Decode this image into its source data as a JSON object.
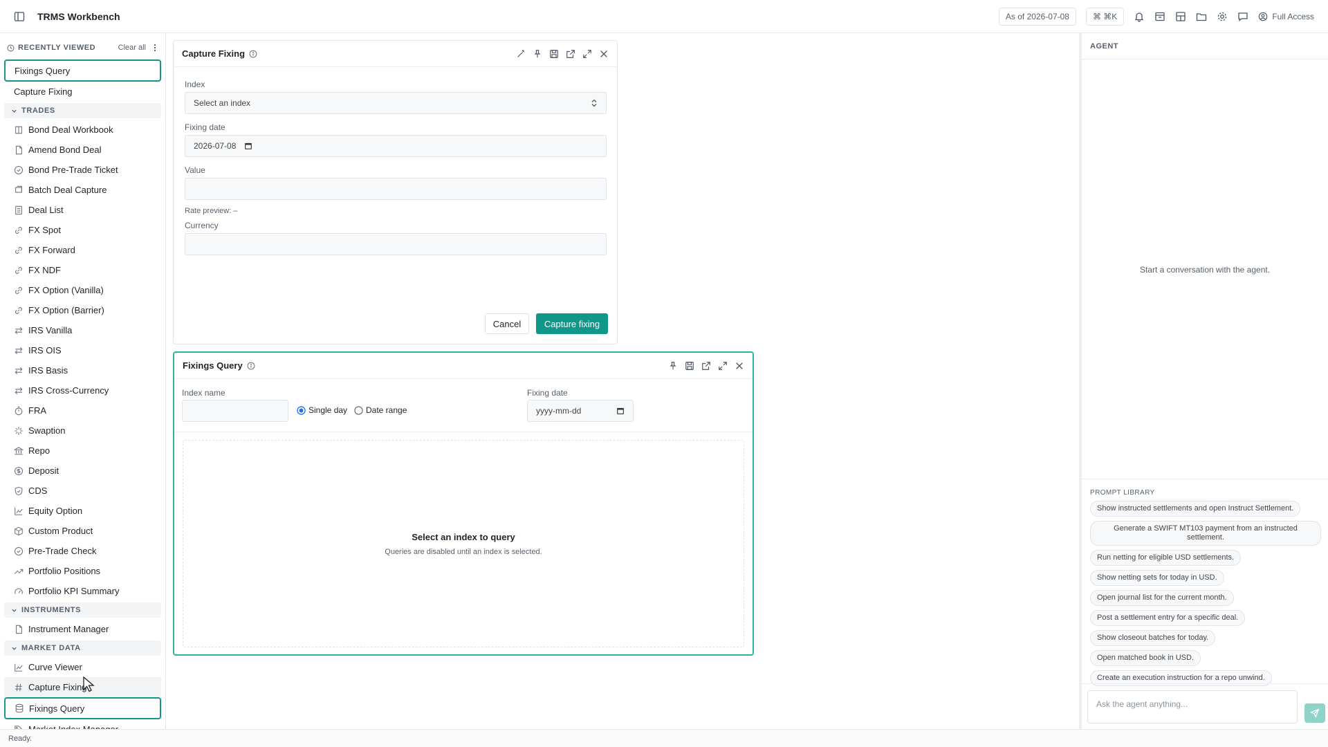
{
  "app": {
    "title": "TRMS Workbench"
  },
  "topbar": {
    "as_of": "As of 2026-07-08",
    "shortcut": "⌘ ⌘K",
    "access": "Full Access"
  },
  "sidebar": {
    "recent_header": "RECENTLY VIEWED",
    "clear_all": "Clear all",
    "recent": [
      "Fixings Query",
      "Capture Fixing"
    ],
    "sections": [
      {
        "name": "TRADES",
        "items": [
          "Bond Deal Workbook",
          "Amend Bond Deal",
          "Bond Pre-Trade Ticket",
          "Batch Deal Capture",
          "Deal List",
          "FX Spot",
          "FX Forward",
          "FX NDF",
          "FX Option (Vanilla)",
          "FX Option (Barrier)",
          "IRS Vanilla",
          "IRS OIS",
          "IRS Basis",
          "IRS Cross-Currency",
          "FRA",
          "Swaption",
          "Repo",
          "Deposit",
          "CDS",
          "Equity Option",
          "Custom Product",
          "Pre-Trade Check",
          "Portfolio Positions",
          "Portfolio KPI Summary"
        ]
      },
      {
        "name": "INSTRUMENTS",
        "items": [
          "Instrument Manager"
        ]
      },
      {
        "name": "MARKET DATA",
        "items": [
          "Curve Viewer",
          "Capture Fixing",
          "Fixings Query",
          "Market Index Manager"
        ]
      }
    ]
  },
  "capture_panel": {
    "title": "Capture Fixing",
    "index_label": "Index",
    "index_placeholder": "Select an index",
    "fixing_date_label": "Fixing date",
    "fixing_date_value": "2026-07-08",
    "value_label": "Value",
    "rate_preview": "Rate preview: –",
    "currency_label": "Currency",
    "cancel": "Cancel",
    "submit": "Capture fixing"
  },
  "query_panel": {
    "title": "Fixings Query",
    "index_name_label": "Index name",
    "single_day": "Single day",
    "date_range": "Date range",
    "fixing_date_label": "Fixing date",
    "fixing_date_placeholder": "yyyy-mm-dd",
    "empty_title": "Select an index to query",
    "empty_sub": "Queries are disabled until an index is selected."
  },
  "agent": {
    "header": "AGENT",
    "empty": "Start a conversation with the agent.",
    "library_header": "PROMPT LIBRARY",
    "prompts": [
      "Show instructed settlements and open Instruct Settlement.",
      "Generate a SWIFT MT103 payment from an instructed settlement.",
      "Run netting for eligible USD settlements.",
      "Show netting sets for today in USD.",
      "Open journal list for the current month.",
      "Post a settlement entry for a specific deal.",
      "Show closeout batches for today.",
      "Open matched book in USD.",
      "Create an execution instruction for a repo unwind."
    ],
    "input_placeholder": "Ask the agent anything..."
  },
  "status": {
    "text": "Ready."
  },
  "colors": {
    "accent": "#11968a",
    "accent_light": "#2bb3a3"
  }
}
